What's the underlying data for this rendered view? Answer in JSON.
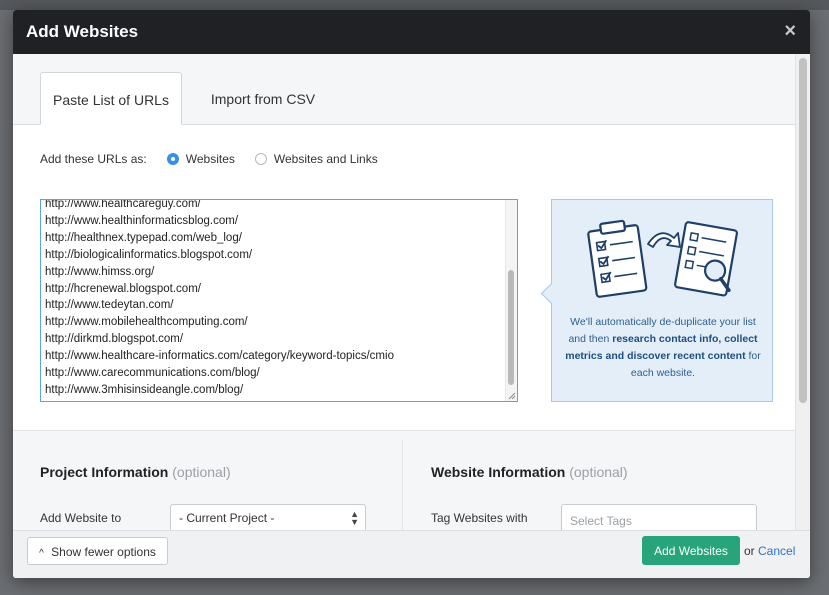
{
  "modal": {
    "title": "Add Websites",
    "close_glyph": "×"
  },
  "tabs": [
    {
      "label": "Paste List of URLs",
      "active": true
    },
    {
      "label": "Import from CSV",
      "active": false
    }
  ],
  "url_type": {
    "label": "Add these URLs as:",
    "options": [
      {
        "label": "Websites",
        "checked": true
      },
      {
        "label": "Websites and Links",
        "checked": false
      }
    ]
  },
  "urls": [
    "http://www.healthcareguy.com/",
    "http://www.healthinformaticsblog.com/",
    "http://healthnex.typepad.com/web_log/",
    "http://biologicalinformatics.blogspot.com/",
    "http://www.himss.org/",
    "http://hcrenewal.blogspot.com/",
    "http://www.tedeytan.com/",
    "http://www.mobilehealthcomputing.com/",
    "http://dirkmd.blogspot.com/",
    "http://www.healthcare-informatics.com/category/keyword-topics/cmio",
    "http://www.carecommunications.com/blog/",
    "http://www.3mhisinsideangle.com/blog/"
  ],
  "info": {
    "text_1": "We'll automatically de-duplicate your list and then ",
    "bold_1": "research contact info, collect metrics and discover recent content",
    "text_2": " for each website."
  },
  "project": {
    "title": "Project Information",
    "optional": "(optional)",
    "add_to_label": "Add Website to",
    "select_value": "- Current Project -"
  },
  "website": {
    "title": "Website Information",
    "optional": "(optional)",
    "tag_label": "Tag Websites with",
    "tag_placeholder": "Select Tags"
  },
  "footer": {
    "fewer_options": "Show fewer options",
    "chevron_glyph": "^",
    "add_button": "Add Websites",
    "or": "or",
    "cancel": "Cancel"
  },
  "colors": {
    "primary": "#27a47a",
    "link": "#2d72c4",
    "radio_checked": "#3a8ee6",
    "header_bg": "#1f2124"
  }
}
